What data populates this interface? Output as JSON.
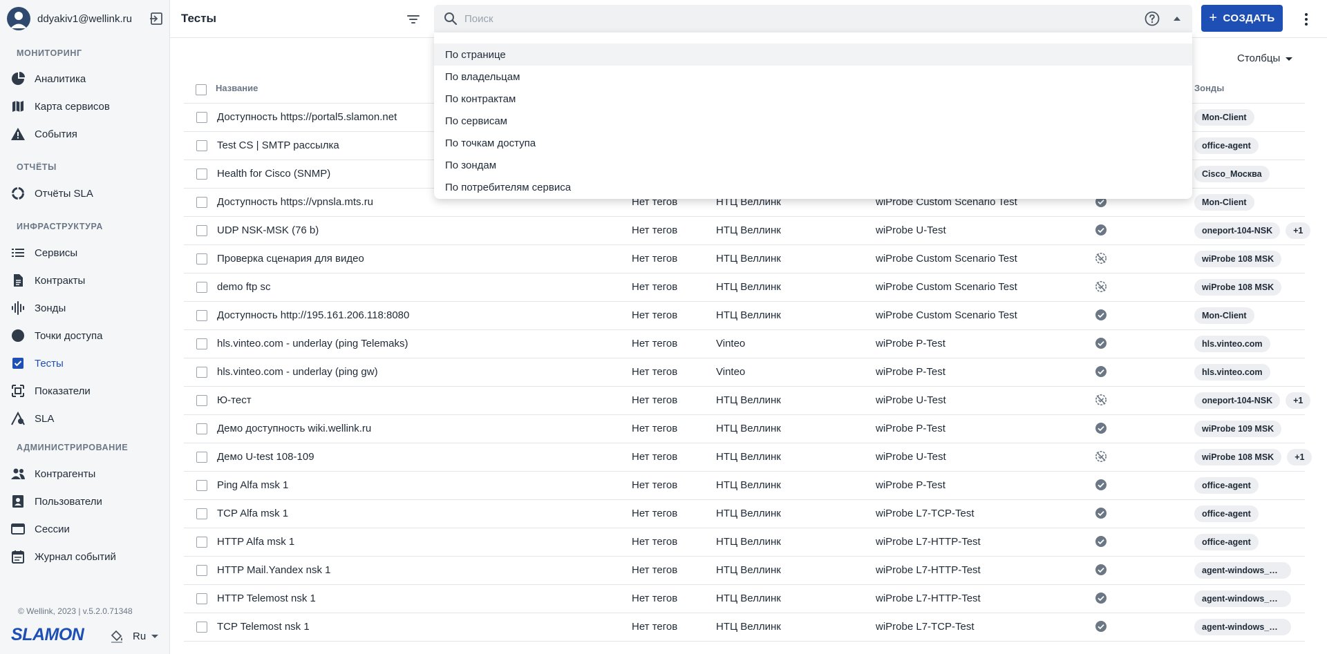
{
  "user": {
    "email": "ddyakiv1@wellink.ru"
  },
  "sidebar": {
    "sections": [
      {
        "title": "МОНИТОРИНГ",
        "items": [
          {
            "label": "Аналитика",
            "icon": "pie-chart-icon"
          },
          {
            "label": "Карта сервисов",
            "icon": "map-icon"
          },
          {
            "label": "События",
            "icon": "warning-icon"
          }
        ]
      },
      {
        "title": "ОТЧЁТЫ",
        "items": [
          {
            "label": "Отчёты SLA",
            "icon": "ring-icon"
          }
        ]
      },
      {
        "title": "ИНФРАСТРУКТУРА",
        "items": [
          {
            "label": "Сервисы",
            "icon": "list-icon"
          },
          {
            "label": "Контракты",
            "icon": "document-icon"
          },
          {
            "label": "Зонды",
            "icon": "waveform-icon"
          },
          {
            "label": "Точки доступа",
            "icon": "circle-icon"
          },
          {
            "label": "Тесты",
            "icon": "checkbox-icon",
            "active": true
          },
          {
            "label": "Показатели",
            "icon": "metrics-icon"
          },
          {
            "label": "SLA",
            "icon": "sla-icon"
          }
        ]
      },
      {
        "title": "АДМИНИСТРИРОВАНИЕ",
        "items": [
          {
            "label": "Контрагенты",
            "icon": "people-icon"
          },
          {
            "label": "Пользователи",
            "icon": "contact-icon"
          },
          {
            "label": "Сессии",
            "icon": "window-icon"
          },
          {
            "label": "Журнал событий",
            "icon": "calendar-icon"
          }
        ]
      }
    ],
    "footer": {
      "copyright": "© Wellink, 2023 | v.5.2.0.71348",
      "logo": "SLAMON",
      "language": "Ru"
    }
  },
  "header": {
    "title": "Тесты",
    "create_label": "СОЗДАТЬ"
  },
  "search": {
    "placeholder": "Поиск",
    "options": [
      "По странице",
      "По владельцам",
      "По контрактам",
      "По сервисам",
      "По точкам доступа",
      "По зондам",
      "По потребителям сервиса"
    ]
  },
  "table": {
    "columns_label": "Столбцы",
    "headers": {
      "name": "Название",
      "probes": "Зонды"
    },
    "rows": [
      {
        "name": "Доступность https://portal5.slamon.net",
        "tags": "",
        "owner": "",
        "type": "",
        "status": "",
        "probes": [
          "Mon-Client"
        ]
      },
      {
        "name": "Test CS | SMTP рассылка",
        "tags": "",
        "owner": "",
        "type": "",
        "status": "",
        "probes": [
          "office-agent"
        ]
      },
      {
        "name": "Health for Cisco (SNMP)",
        "tags": "",
        "owner": "",
        "type": "",
        "status": "",
        "probes": [
          "Cisco_Москва"
        ]
      },
      {
        "name": "Доступность https://vpnsla.mts.ru",
        "tags": "Нет тегов",
        "owner": "НТЦ Веллинк",
        "type": "wiProbe Custom Scenario Test",
        "status": "enabled",
        "probes": [
          "Mon-Client"
        ]
      },
      {
        "name": "UDP NSK-MSK (76 b)",
        "tags": "Нет тегов",
        "owner": "НТЦ Веллинк",
        "type": "wiProbe U-Test",
        "status": "enabled",
        "probes": [
          "oneport-104-NSK",
          "+1"
        ]
      },
      {
        "name": "Проверка сценария для видео",
        "tags": "Нет тегов",
        "owner": "НТЦ Веллинк",
        "type": "wiProbe Custom Scenario Test",
        "status": "disabled",
        "probes": [
          "wiProbe 108 MSK"
        ]
      },
      {
        "name": "demo ftp sc",
        "tags": "Нет тегов",
        "owner": "НТЦ Веллинк",
        "type": "wiProbe Custom Scenario Test",
        "status": "disabled",
        "probes": [
          "wiProbe 108 MSK"
        ]
      },
      {
        "name": "Доступность http://195.161.206.118:8080",
        "tags": "Нет тегов",
        "owner": "НТЦ Веллинк",
        "type": "wiProbe Custom Scenario Test",
        "status": "enabled",
        "probes": [
          "Mon-Client"
        ]
      },
      {
        "name": "hls.vinteo.com - underlay (ping Telemaks)",
        "tags": "Нет тегов",
        "owner": "Vinteo",
        "type": "wiProbe P-Test",
        "status": "enabled",
        "probes": [
          "hls.vinteo.com"
        ]
      },
      {
        "name": "hls.vinteo.com - underlay (ping gw)",
        "tags": "Нет тегов",
        "owner": "Vinteo",
        "type": "wiProbe P-Test",
        "status": "enabled",
        "probes": [
          "hls.vinteo.com"
        ]
      },
      {
        "name": "Ю-тест",
        "tags": "Нет тегов",
        "owner": "НТЦ Веллинк",
        "type": "wiProbe U-Test",
        "status": "disabled",
        "probes": [
          "oneport-104-NSK",
          "+1"
        ]
      },
      {
        "name": "Демо доступность wiki.wellink.ru",
        "tags": "Нет тегов",
        "owner": "НТЦ Веллинк",
        "type": "wiProbe P-Test",
        "status": "enabled",
        "probes": [
          "wiProbe 109 MSK"
        ]
      },
      {
        "name": "Демо U-test 108-109",
        "tags": "Нет тегов",
        "owner": "НТЦ Веллинк",
        "type": "wiProbe U-Test",
        "status": "disabled",
        "probes": [
          "wiProbe 108 MSK",
          "+1"
        ]
      },
      {
        "name": "Ping Alfa msk 1",
        "tags": "Нет тегов",
        "owner": "НТЦ Веллинк",
        "type": "wiProbe P-Test",
        "status": "enabled",
        "probes": [
          "office-agent"
        ]
      },
      {
        "name": "TCP Alfa msk 1",
        "tags": "Нет тегов",
        "owner": "НТЦ Веллинк",
        "type": "wiProbe L7-TCP-Test",
        "status": "enabled",
        "probes": [
          "office-agent"
        ]
      },
      {
        "name": "HTTP Alfa msk 1",
        "tags": "Нет тегов",
        "owner": "НТЦ Веллинк",
        "type": "wiProbe L7-HTTP-Test",
        "status": "enabled",
        "probes": [
          "office-agent"
        ]
      },
      {
        "name": "HTTP Mail.Yandex nsk 1",
        "tags": "Нет тегов",
        "owner": "НТЦ Веллинк",
        "type": "wiProbe L7-HTTP-Test",
        "status": "enabled",
        "probes": [
          "agent-windows_No..."
        ]
      },
      {
        "name": "HTTP Telemost nsk 1",
        "tags": "Нет тегов",
        "owner": "НТЦ Веллинк",
        "type": "wiProbe L7-HTTP-Test",
        "status": "enabled",
        "probes": [
          "agent-windows_No..."
        ]
      },
      {
        "name": "TCP Telemost nsk 1",
        "tags": "Нет тегов",
        "owner": "НТЦ Веллинк",
        "type": "wiProbe L7-TCP-Test",
        "status": "enabled",
        "probes": [
          "agent-windows_No..."
        ]
      }
    ]
  },
  "colors": {
    "accent": "#1e4fb5",
    "sidebar_bg": "#f5f6f8",
    "chip_bg": "#eceef1"
  }
}
